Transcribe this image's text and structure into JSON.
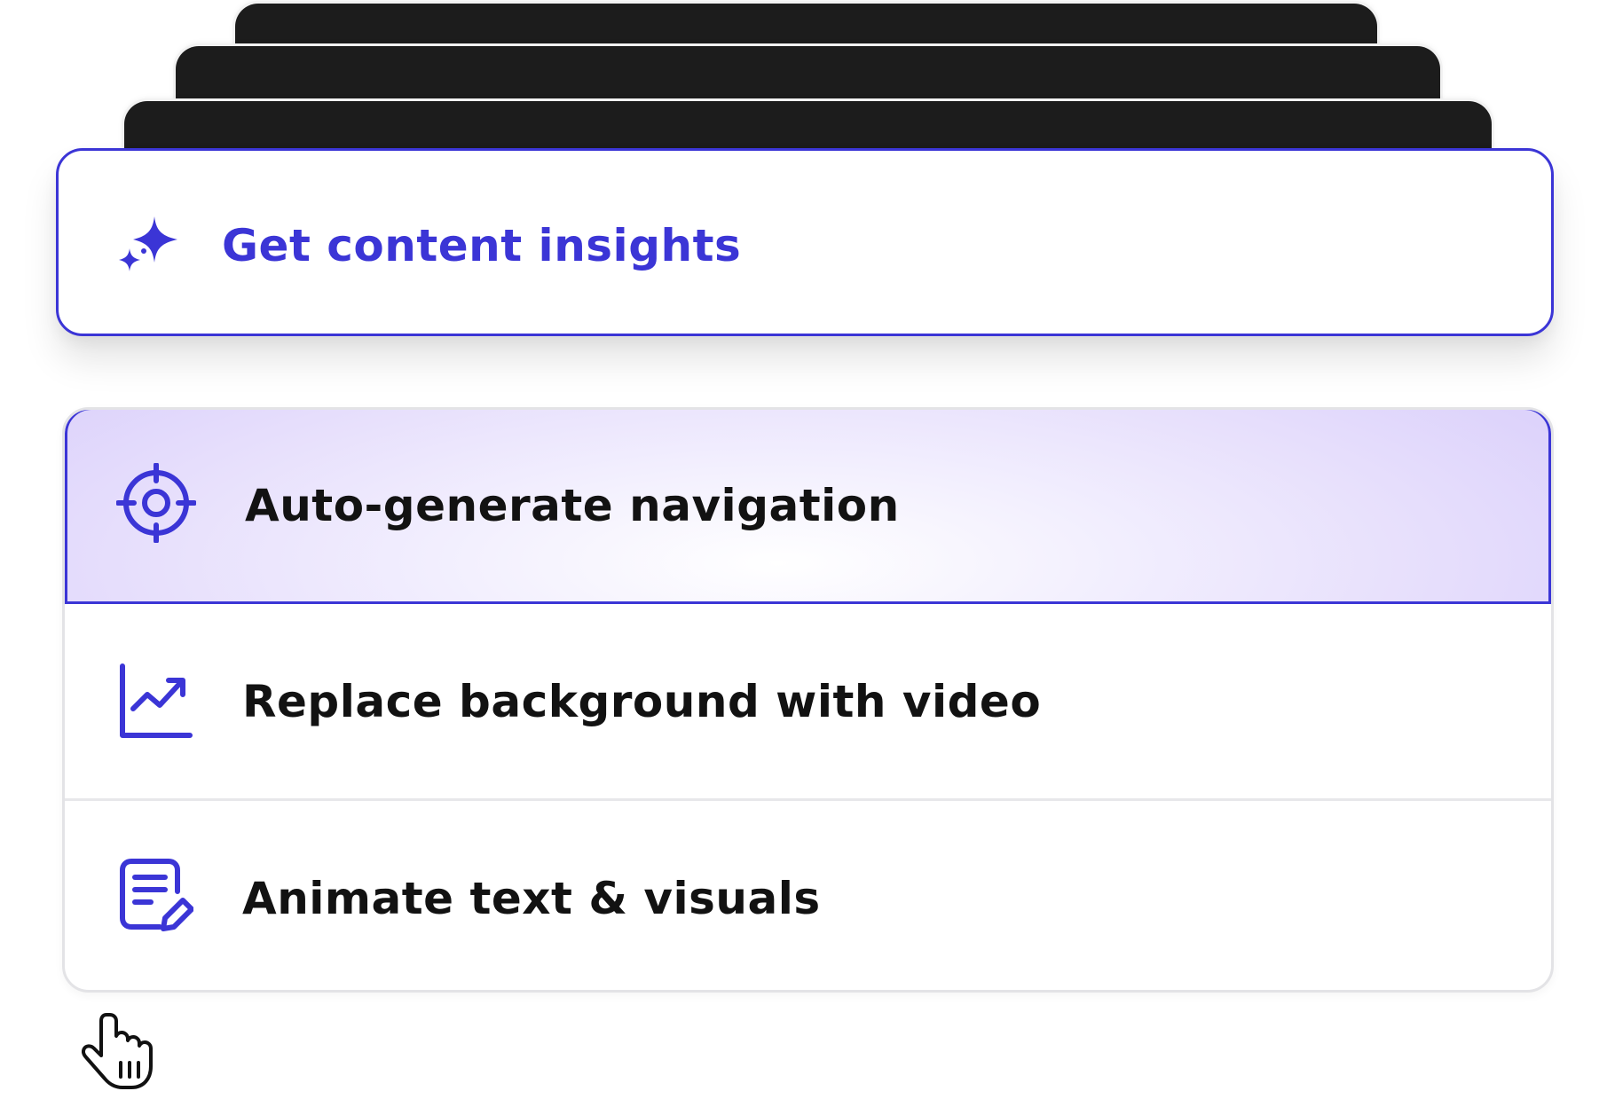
{
  "insights_card": {
    "label": "Get content insights",
    "icon": "sparkle-icon"
  },
  "menu": {
    "items": [
      {
        "label": "Auto-generate navigation",
        "icon": "crosshair-target-icon",
        "state": "active"
      },
      {
        "label": "Replace background with video",
        "icon": "trending-chart-icon",
        "state": "default"
      },
      {
        "label": "Animate text & visuals",
        "icon": "document-edit-icon",
        "state": "default"
      }
    ]
  },
  "cursor": {
    "icon": "hand-pointer-cursor-icon"
  },
  "colors": {
    "accent": "#3b35d6",
    "stack_card": "#1c1c1c",
    "active_bg": "#e6defc",
    "text": "#121212",
    "border": "#e3e3e6"
  }
}
